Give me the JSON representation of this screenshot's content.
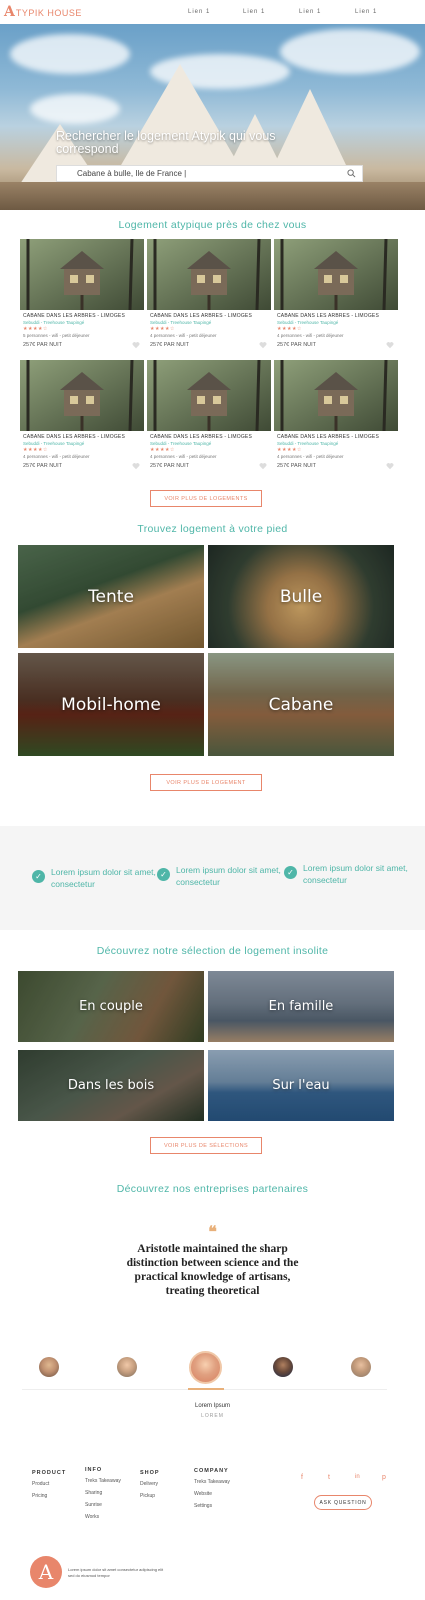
{
  "header": {
    "logo_letter": "A",
    "logo_text": "TYPIK HOUSE",
    "nav": [
      "Lien 1",
      "Lien 1",
      "Lien 1",
      "Lien 1"
    ]
  },
  "hero": {
    "title": "Rechercher le logement Atypik qui vous correspond",
    "search_value": "Cabane à bulle, Ile de France |",
    "search_icon": "search-icon"
  },
  "nearby": {
    "title": "Logement atypique près de chez vous",
    "cards": [
      {
        "title": "CABANE DANS LES ARBRES - LIMOGES",
        "location": "Sebuddi - Treehouse Taupingé",
        "stars": "★★★★☆",
        "features": "5 personnes - wifi - petit déjeuner",
        "price": "257€ PAR NUIT"
      },
      {
        "title": "CABANE DANS LES ARBRES - LIMOGES",
        "location": "Sebuddi - Treehouse Taupingé",
        "stars": "★★★★☆",
        "features": "4 personnes - wifi - petit déjeuner",
        "price": "257€ PAR NUIT"
      },
      {
        "title": "CABANE DANS LES ARBRES - LIMOGES",
        "location": "Sebuddi - Treehouse Taupingé",
        "stars": "★★★★☆",
        "features": "4 personnes - wifi - petit déjeuner",
        "price": "257€ PAR NUIT"
      },
      {
        "title": "CABANE DANS LES ARBRES - LIMOGES",
        "location": "Sebuddi - Treehouse Taupingé",
        "stars": "★★★★☆",
        "features": "4 personnes - wifi - petit déjeuner",
        "price": "257€ PAR NUIT"
      },
      {
        "title": "CABANE DANS LES ARBRES - LIMOGES",
        "location": "Sebuddi - Treehouse Taupingé",
        "stars": "★★★★☆",
        "features": "4 personnes - wifi - petit déjeuner",
        "price": "257€ PAR NUIT"
      },
      {
        "title": "CABANE DANS LES ARBRES - LIMOGES",
        "location": "Sebuddi - Treehouse Taupingé",
        "stars": "★★★★☆",
        "features": "4 personnes - wifi - petit déjeuner",
        "price": "257€ PAR NUIT"
      }
    ],
    "more_button": "VOIR PLUS DE LOGEMENTS"
  },
  "types": {
    "title": "Trouvez logement à votre pied",
    "tiles": [
      "Tente",
      "Bulle",
      "Mobil-home",
      "Cabane"
    ],
    "more_button": "VOIR PLUS DE LOGEMENT"
  },
  "features": [
    "Lorem ipsum dolor sit amet, consectetur",
    "Lorem ipsum dolor sit amet, consectetur",
    "Lorem ipsum dolor sit amet, consectetur"
  ],
  "selection": {
    "title": "Découvrez notre sélection de logement insolite",
    "tiles": [
      "En couple",
      "En famille",
      "Dans les bois",
      "Sur l'eau"
    ],
    "more_button": "VOIR PLUS DE SÉLECTIONS"
  },
  "partners": {
    "title": "Découvrez nos entreprises partenaires",
    "quote_mark": "❝",
    "quote": "Aristotle maintained the sharp distinction between science and the practical knowledge of artisans, treating theoretical",
    "name": "Lorem Ipsum",
    "role": "LOREM"
  },
  "footer": {
    "columns": [
      {
        "head": "PRODUCT",
        "items": [
          "Product",
          "Pricing"
        ]
      },
      {
        "head": "INFO",
        "items": [
          "Treks Takeaway",
          "Sharing",
          "Sunrise",
          "Works"
        ]
      },
      {
        "head": "SHOP",
        "items": [
          "Delivery",
          "Pickup"
        ]
      },
      {
        "head": "COMPANY",
        "items": [
          "Treks Takeaway",
          "Website",
          "Settings"
        ]
      }
    ],
    "social": [
      "f",
      "t",
      "in",
      "p"
    ],
    "ask_button": "ASK QUESTION",
    "logo_letter": "A",
    "legal": "Lorem ipsum dolor sit amet consectetur adipiscing elit sed do eiusmod tempor"
  },
  "colors": {
    "accent": "#e8866b",
    "teal": "#4fb6a8"
  }
}
